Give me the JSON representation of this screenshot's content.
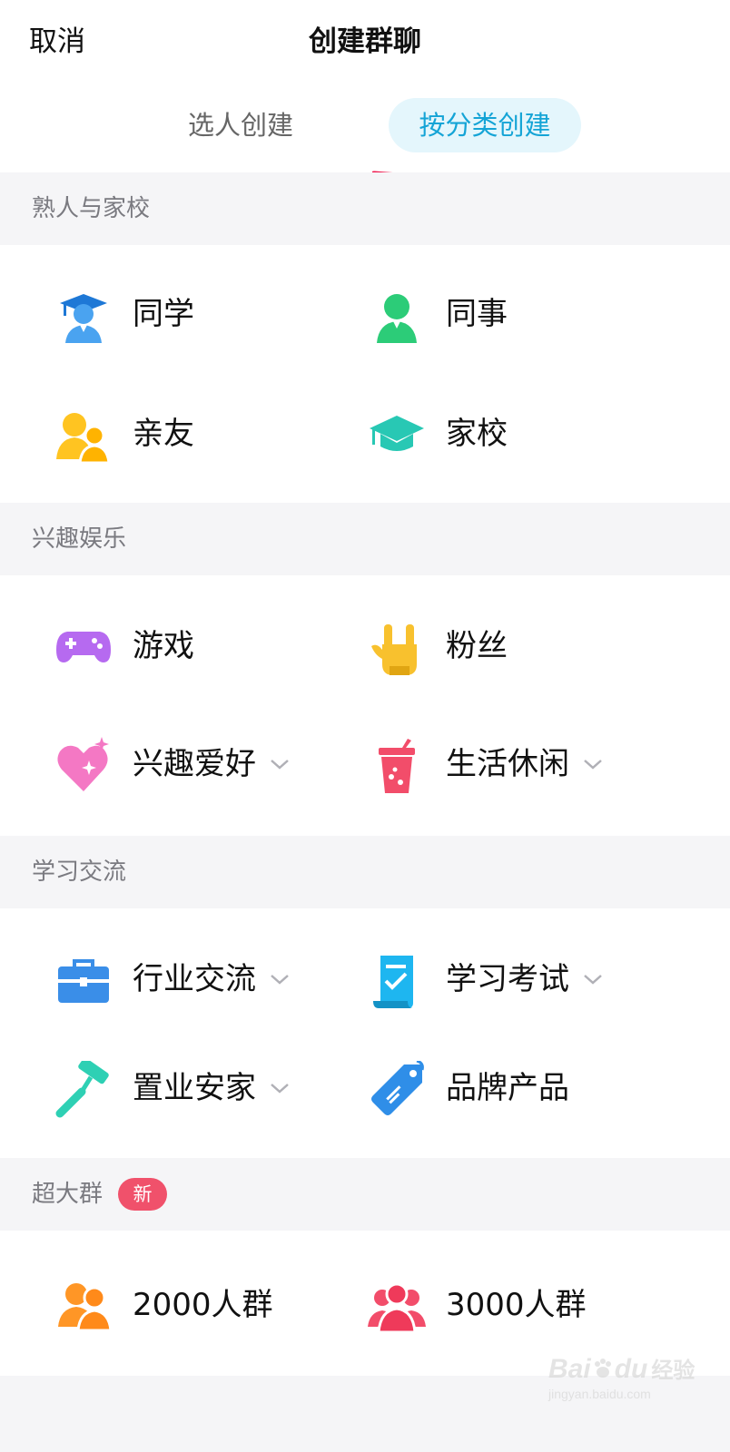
{
  "header": {
    "cancel": "取消",
    "title": "创建群聊",
    "tabs": [
      "选人创建",
      "按分类创建"
    ]
  },
  "sections": [
    {
      "title": "熟人与家校",
      "items": [
        {
          "label": "同学",
          "icon": "student-icon"
        },
        {
          "label": "同事",
          "icon": "colleague-icon"
        },
        {
          "label": "亲友",
          "icon": "friends-icon"
        },
        {
          "label": "家校",
          "icon": "graduation-cap-icon"
        }
      ]
    },
    {
      "title": "兴趣娱乐",
      "items": [
        {
          "label": "游戏",
          "icon": "gamepad-icon"
        },
        {
          "label": "粉丝",
          "icon": "rock-hand-icon"
        },
        {
          "label": "兴趣爱好",
          "icon": "heart-icon",
          "expandable": true
        },
        {
          "label": "生活休闲",
          "icon": "drink-cup-icon",
          "expandable": true
        }
      ]
    },
    {
      "title": "学习交流",
      "items": [
        {
          "label": "行业交流",
          "icon": "briefcase-icon",
          "expandable": true
        },
        {
          "label": "学习考试",
          "icon": "exam-paper-icon",
          "expandable": true
        },
        {
          "label": "置业安家",
          "icon": "paint-roller-icon",
          "expandable": true
        },
        {
          "label": "品牌产品",
          "icon": "tag-icon"
        }
      ]
    },
    {
      "title": "超大群",
      "badge": "新",
      "items": [
        {
          "label": "2000人群",
          "icon": "group-orange-icon"
        },
        {
          "label": "3000人群",
          "icon": "group-red-icon"
        }
      ]
    }
  ],
  "watermark": {
    "brand": "Bai",
    "brand2": "du",
    "cn": "经验",
    "url": "jingyan.baidu.com"
  },
  "colors": {
    "accent": "#14a4d6",
    "accent_bg": "#e4f6fc",
    "badge": "#f0516b",
    "annotation": "#f0174c"
  }
}
